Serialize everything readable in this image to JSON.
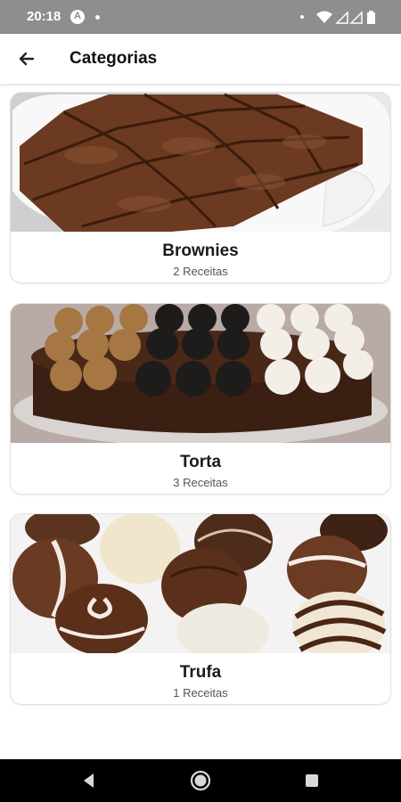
{
  "status_bar": {
    "time": "20:18",
    "icons": [
      "notification-a-icon",
      "dot-icon",
      "wifi-icon",
      "signal-icon",
      "battery-icon"
    ]
  },
  "app_bar": {
    "back_icon": "arrow-left-icon",
    "title": "Categorias"
  },
  "categories": [
    {
      "name": "Brownies",
      "count": "2 Receitas",
      "image": "brownies-photo"
    },
    {
      "name": "Torta",
      "count": "3 Receitas",
      "image": "chocolate-cake-photo"
    },
    {
      "name": "Trufa",
      "count": "1 Receitas",
      "image": "truffles-photo"
    }
  ],
  "nav_bar": {
    "icons": [
      "back-triangle-icon",
      "home-circle-icon",
      "recents-square-icon"
    ]
  },
  "colors": {
    "status_bar": "#8e8e8e",
    "app_bar": "#ffffff",
    "nav_bar": "#000000",
    "title_text": "#111111",
    "subtitle_text": "#555555"
  }
}
